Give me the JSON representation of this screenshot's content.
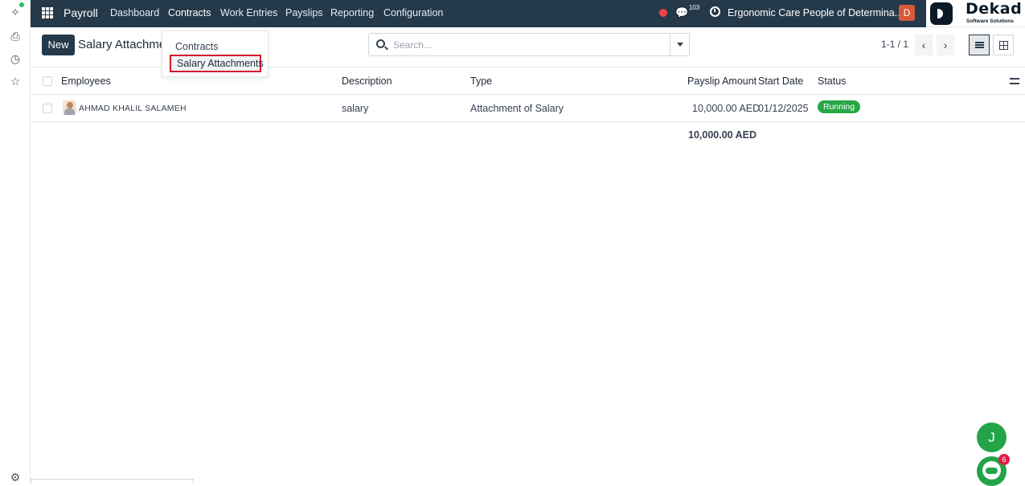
{
  "navbar": {
    "app_name": "Payroll",
    "menus": [
      "Dashboard",
      "Contracts",
      "Work Entries",
      "Payslips",
      "Reporting",
      "Configuration"
    ],
    "chat_count": "103",
    "company": "Ergonomic Care People of Determina...",
    "user_initial": "D"
  },
  "logo": {
    "name": "Dekad",
    "tagline": "Software Solutions"
  },
  "control": {
    "new_label": "New",
    "title": "Salary Attachments",
    "search_placeholder": "Search...",
    "pager": "1-1 / 1"
  },
  "dropdown": {
    "items": [
      "Contracts",
      "Salary Attachments"
    ],
    "highlighted": "Salary Attachments"
  },
  "table": {
    "columns": [
      "Employees",
      "Description",
      "Type",
      "Payslip Amount",
      "Start Date",
      "Status"
    ],
    "rows": [
      {
        "employee": "AHMAD KHALIL SALAMEH",
        "description": "salary",
        "type": "Attachment of Salary",
        "amount": "10,000.00 AED",
        "start_date": "01/12/2025",
        "status": "Running"
      }
    ],
    "total": "10,000.00 AED"
  },
  "floating": {
    "assistant_initial": "J",
    "chat_badge": "6"
  },
  "colors": {
    "navbar": "#243a4b",
    "accent_red": "#d11a2a",
    "status_green": "#28a745"
  }
}
